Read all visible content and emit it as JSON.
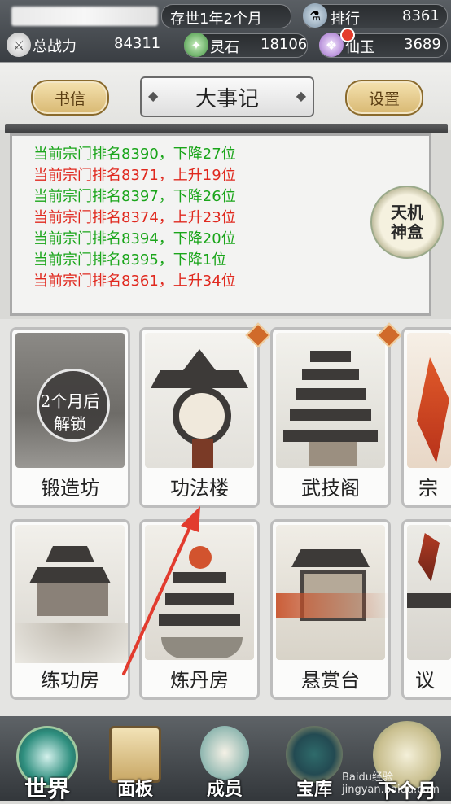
{
  "topbar": {
    "calendar": "存世1年2个月",
    "ranking_label": "排行",
    "ranking_value": "8361",
    "power_label": "总战力",
    "power_value": "84311",
    "spirit_stone_label": "灵石",
    "spirit_stone_value": "18106",
    "jade_label": "仙玉",
    "jade_value": "3689"
  },
  "header": {
    "left_button": "书信",
    "title": "大事记",
    "right_button": "设置"
  },
  "log": [
    {
      "text": "当前宗门排名8390，下降27位",
      "color": "#1aa51a"
    },
    {
      "text": "当前宗门排名8371，上升19位",
      "color": "#e0281e"
    },
    {
      "text": "当前宗门排名8397，下降26位",
      "color": "#1aa51a"
    },
    {
      "text": "当前宗门排名8374，上升23位",
      "color": "#e0281e"
    },
    {
      "text": "当前宗门排名8394，下降20位",
      "color": "#1aa51a"
    },
    {
      "text": "当前宗门排名8395，下降1位",
      "color": "#1aa51a"
    },
    {
      "text": "当前宗门排名8361，上升34位",
      "color": "#e0281e"
    }
  ],
  "tianji": {
    "line1": "天机",
    "line2": "神盒"
  },
  "buildings": {
    "row1": [
      {
        "label": "锻造坊",
        "lock_line1": "2个月后",
        "lock_line2": "解锁"
      },
      {
        "label": "功法楼"
      },
      {
        "label": "武技阁"
      },
      {
        "label": "宗"
      }
    ],
    "row2": [
      {
        "label": "练功房"
      },
      {
        "label": "炼丹房"
      },
      {
        "label": "悬赏台"
      },
      {
        "label": "议"
      }
    ]
  },
  "nav": [
    {
      "label": "世界"
    },
    {
      "label": "面板"
    },
    {
      "label": "成员"
    },
    {
      "label": "宝库"
    },
    {
      "label": "下个月"
    }
  ],
  "watermark": "Baidu经验 jingyan.baidu.com",
  "colors": {
    "gain": "#e0281e",
    "loss": "#1aa51a",
    "gold": "#d8b872",
    "annotation_arrow": "#e23b2e"
  }
}
